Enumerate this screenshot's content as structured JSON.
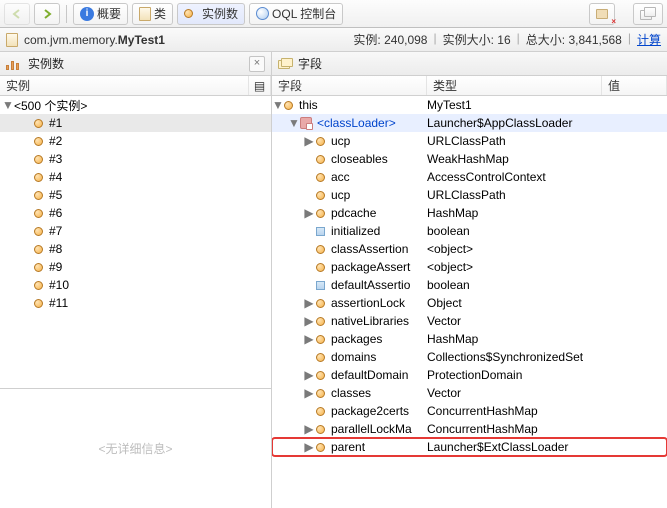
{
  "toolbar": {
    "back": "后退",
    "fwd": "前进",
    "overview": "概要",
    "classes": "类",
    "instances": "实例数",
    "oql": "OQL 控制台"
  },
  "breadcrumb": {
    "prefix": "com.jvm.memory.",
    "cls": "MyTest1"
  },
  "stats": {
    "instances_label": "实例:",
    "instances_value": "240,098",
    "size_label": "实例大小:",
    "size_value": "16",
    "total_label": "总大小:",
    "total_value": "3,841,568",
    "calc": "计算"
  },
  "left": {
    "panel_title": "实例数",
    "head_col": "实例",
    "root_label": "<500 个实例>",
    "rows": [
      "#1",
      "#2",
      "#3",
      "#4",
      "#5",
      "#6",
      "#7",
      "#8",
      "#9",
      "#10",
      "#11"
    ],
    "selected": 0,
    "no_detail": "<无详细信息>"
  },
  "right": {
    "panel_title": "字段",
    "head_field": "字段",
    "head_type": "类型",
    "head_value": "值",
    "rows": [
      {
        "depth": 0,
        "disc": "down",
        "icon": "bullet",
        "field": "this",
        "type": "MyTest1",
        "sel": false
      },
      {
        "depth": 1,
        "disc": "down",
        "icon": "cl",
        "field": "<classLoader>",
        "type": "Launcher$AppClassLoader",
        "sel": true
      },
      {
        "depth": 2,
        "disc": "right",
        "icon": "bullet",
        "field": "ucp",
        "type": "URLClassPath"
      },
      {
        "depth": 2,
        "disc": "",
        "icon": "bullet",
        "field": "closeables",
        "type": "WeakHashMap"
      },
      {
        "depth": 2,
        "disc": "",
        "icon": "bullet",
        "field": "acc",
        "type": "AccessControlContext"
      },
      {
        "depth": 2,
        "disc": "",
        "icon": "bullet",
        "field": "ucp",
        "type": "URLClassPath"
      },
      {
        "depth": 2,
        "disc": "right",
        "icon": "bullet",
        "field": "pdcache",
        "type": "HashMap"
      },
      {
        "depth": 2,
        "disc": "",
        "icon": "sq",
        "field": "initialized",
        "type": "boolean"
      },
      {
        "depth": 2,
        "disc": "",
        "icon": "bullet",
        "field": "classAssertion",
        "type": "<object>"
      },
      {
        "depth": 2,
        "disc": "",
        "icon": "bullet",
        "field": "packageAssert",
        "type": "<object>"
      },
      {
        "depth": 2,
        "disc": "",
        "icon": "sq",
        "field": "defaultAssertio",
        "type": "boolean"
      },
      {
        "depth": 2,
        "disc": "right",
        "icon": "bullet",
        "field": "assertionLock",
        "type": "Object"
      },
      {
        "depth": 2,
        "disc": "right",
        "icon": "bullet",
        "field": "nativeLibraries",
        "type": "Vector"
      },
      {
        "depth": 2,
        "disc": "right",
        "icon": "bullet",
        "field": "packages",
        "type": "HashMap"
      },
      {
        "depth": 2,
        "disc": "",
        "icon": "bullet",
        "field": "domains",
        "type": "Collections$SynchronizedSet"
      },
      {
        "depth": 2,
        "disc": "right",
        "icon": "bullet",
        "field": "defaultDomain",
        "type": "ProtectionDomain"
      },
      {
        "depth": 2,
        "disc": "right",
        "icon": "bullet",
        "field": "classes",
        "type": "Vector"
      },
      {
        "depth": 2,
        "disc": "",
        "icon": "bullet",
        "field": "package2certs",
        "type": "ConcurrentHashMap"
      },
      {
        "depth": 2,
        "disc": "right",
        "icon": "bullet",
        "field": "parallelLockMa",
        "type": "ConcurrentHashMap"
      },
      {
        "depth": 2,
        "disc": "right",
        "icon": "bullet",
        "field": "parent",
        "type": "Launcher$ExtClassLoader",
        "hl": true
      }
    ]
  }
}
